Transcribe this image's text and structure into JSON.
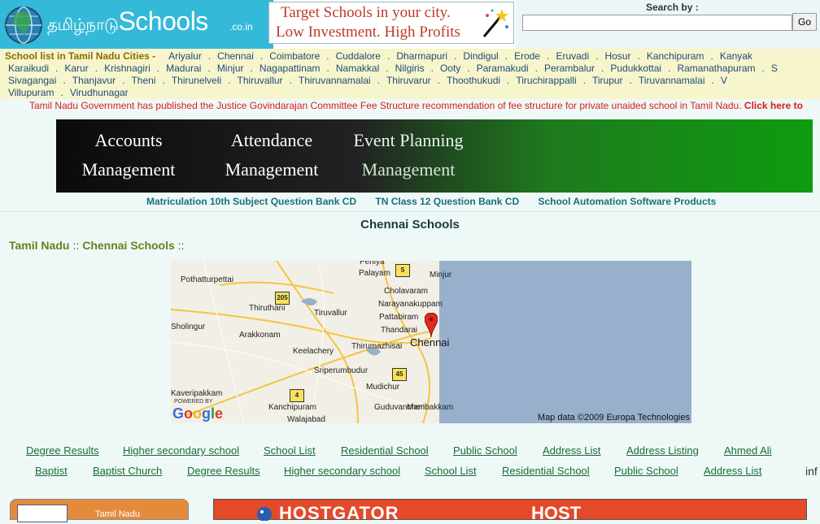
{
  "header": {
    "logo_tamil": "தமிழ்நாடு",
    "logo_name": "Schools",
    "logo_tld": ".co.in",
    "ad_line1": "Target Schools  in your city.",
    "ad_line2": "Low Investment. High Profits",
    "search_label": "Search by :",
    "search_value": "",
    "go_label": "Go"
  },
  "city_bar": {
    "title": "School list in Tamil Nadu Cities -",
    "line1": [
      "Ariyalur",
      "Chennai",
      "Coimbatore",
      "Cuddalore",
      "Dharmapuri",
      "Dindigul",
      "Erode",
      "Eruvadi",
      "Hosur",
      "Kanchipuram",
      "Kanyak"
    ],
    "line2": [
      "Karaikudi",
      "Karur",
      "Krishnagiri",
      "Madurai",
      "Minjur",
      "Nagapattinam",
      "Namakkal",
      "Nilgiris",
      "Ooty",
      "Paramakudi",
      "Perambalur",
      "Pudukkottai",
      "Ramanathapuram",
      "S"
    ],
    "line3": [
      "Sivagangai",
      "Thanjavur",
      "Theni",
      "Thirunelveli",
      "Thiruvallur",
      "Thiruvannamalai",
      "Thiruvarur",
      "Thoothukudi",
      "Tiruchirappalli",
      "Tirupur",
      "Tiruvannamalai",
      "V"
    ],
    "line4": [
      "Villupuram",
      "Virudhunagar"
    ]
  },
  "notice": {
    "text": "Tamil Nadu Government has published the Justice Govindarajan Committee Fee Structure recommendation of fee structure for private unaided school in Tamil Nadu.",
    "link": "Click here to"
  },
  "promo": {
    "item1_line1": "Accounts",
    "item1_line2": "Management",
    "item2_line1": "Attendance",
    "item2_line2": "Management",
    "item3_line1": "Event Planning",
    "item3_line2": "Management"
  },
  "product_links": [
    "Matriculation 10th Subject Question Bank CD",
    "TN Class 12 Question Bank CD",
    "School Automation Software Products"
  ],
  "page_title": "Chennai Schools",
  "breadcrumb": {
    "root": "Tamil Nadu",
    "sep": "::",
    "current": "Chennai Schools",
    "trail": "::"
  },
  "map": {
    "city": "Chennai",
    "attribution": "Map data ©2009 Europa Technologies",
    "powered_by": "POWERED BY",
    "google": "Google",
    "towns": [
      "Peniya",
      "Palayam",
      "Minjur",
      "Pothatturpettai",
      "Cholavaram",
      "Narayanakuppam",
      "Thiruthani",
      "Tiruvallur",
      "Pattabiram",
      "Sholingur",
      "Thandarai",
      "Arakkonam",
      "Keelachery",
      "Thirumazhisai",
      "Sriperumbudur",
      "Mudichur",
      "Kaveripakkam",
      "Kanchipuram",
      "Guduvancheri",
      "Mambakkam",
      "Walajabad"
    ],
    "shields": [
      "5",
      "205",
      "45",
      "4"
    ]
  },
  "links_row1": [
    "Degree Results",
    "Higher secondary school",
    "School List",
    "Residential School",
    "Public School",
    "Address List",
    "Address Listing",
    "Ahmed Ali"
  ],
  "links_row2": [
    "Baptist",
    "Baptist Church",
    "Degree Results",
    "Higher secondary school",
    "School List",
    "Residential School",
    "Public School",
    "Address List"
  ],
  "tail_text": "inf",
  "bottom": {
    "left_label": "Tamil Nadu",
    "right_brand": "HOSTGATOR",
    "right_host": "HOST"
  }
}
